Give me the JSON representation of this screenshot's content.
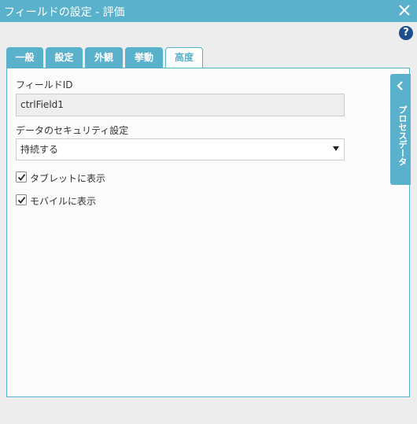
{
  "window": {
    "title": "フィールドの設定 - 評価"
  },
  "tabs": [
    {
      "label": "一般"
    },
    {
      "label": "設定"
    },
    {
      "label": "外観"
    },
    {
      "label": "挙動"
    },
    {
      "label": "高度"
    }
  ],
  "active_tab": "高度",
  "form": {
    "field_id_label": "フィールドID",
    "field_id_value": "ctrlField1",
    "security_label": "データのセキュリティ設定",
    "security_selected": "持続する",
    "tablet_label": "タブレットに表示",
    "tablet_checked": true,
    "mobile_label": "モバイルに表示",
    "mobile_checked": true
  },
  "side_panel": {
    "label": "プロセスデータ"
  },
  "colors": {
    "accent": "#5ab1cb",
    "help": "#1f4e8c"
  }
}
